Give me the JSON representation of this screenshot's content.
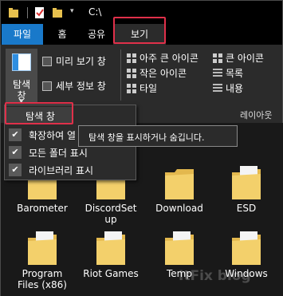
{
  "window": {
    "title": "C:\\"
  },
  "tabs": {
    "file": "파일",
    "home": "홈",
    "share": "공유",
    "view": "보기"
  },
  "ribbon": {
    "nav_pane_line1": "탐색",
    "nav_pane_line2": "창",
    "preview_pane": "미리 보기 창",
    "details_pane": "세부 정보 창",
    "layout": {
      "extra_large_icons": "아주 큰 아이콘",
      "large_icons": "큰 아이콘",
      "small_icons": "작은 아이콘",
      "list": "목록",
      "tiles": "타일",
      "content": "내용"
    },
    "layout_group_label": "레이아웃"
  },
  "dropdown": {
    "items": [
      {
        "label": "탐색 창",
        "checked": true
      },
      {
        "label": "확장하여 열",
        "checked": true
      },
      {
        "label": "모든 폴더 표시",
        "checked": true
      },
      {
        "label": "라이브러리 표시",
        "checked": true
      }
    ]
  },
  "tooltip": {
    "text": "탐색 창을 표시하거나 숨깁니다."
  },
  "files": [
    {
      "name": "Barometer",
      "icon": "folder-icon"
    },
    {
      "name": "DiscordSet\nup",
      "icon": "folder-icon"
    },
    {
      "name": "Download",
      "icon": "folder-icon"
    },
    {
      "name": "ESD",
      "icon": "folder-icon"
    },
    {
      "name": "Program\nFiles (x86)",
      "icon": "folder-icon"
    },
    {
      "name": "Riot Games",
      "icon": "folder-icon"
    },
    {
      "name": "Temp",
      "icon": "folder-icon"
    },
    {
      "name": "Windows",
      "icon": "folder-icon"
    }
  ],
  "watermark": "ItFix blog",
  "colors": {
    "accent": "#1979ca",
    "highlight_box": "#e0304a",
    "folder": "#f3d06b"
  }
}
